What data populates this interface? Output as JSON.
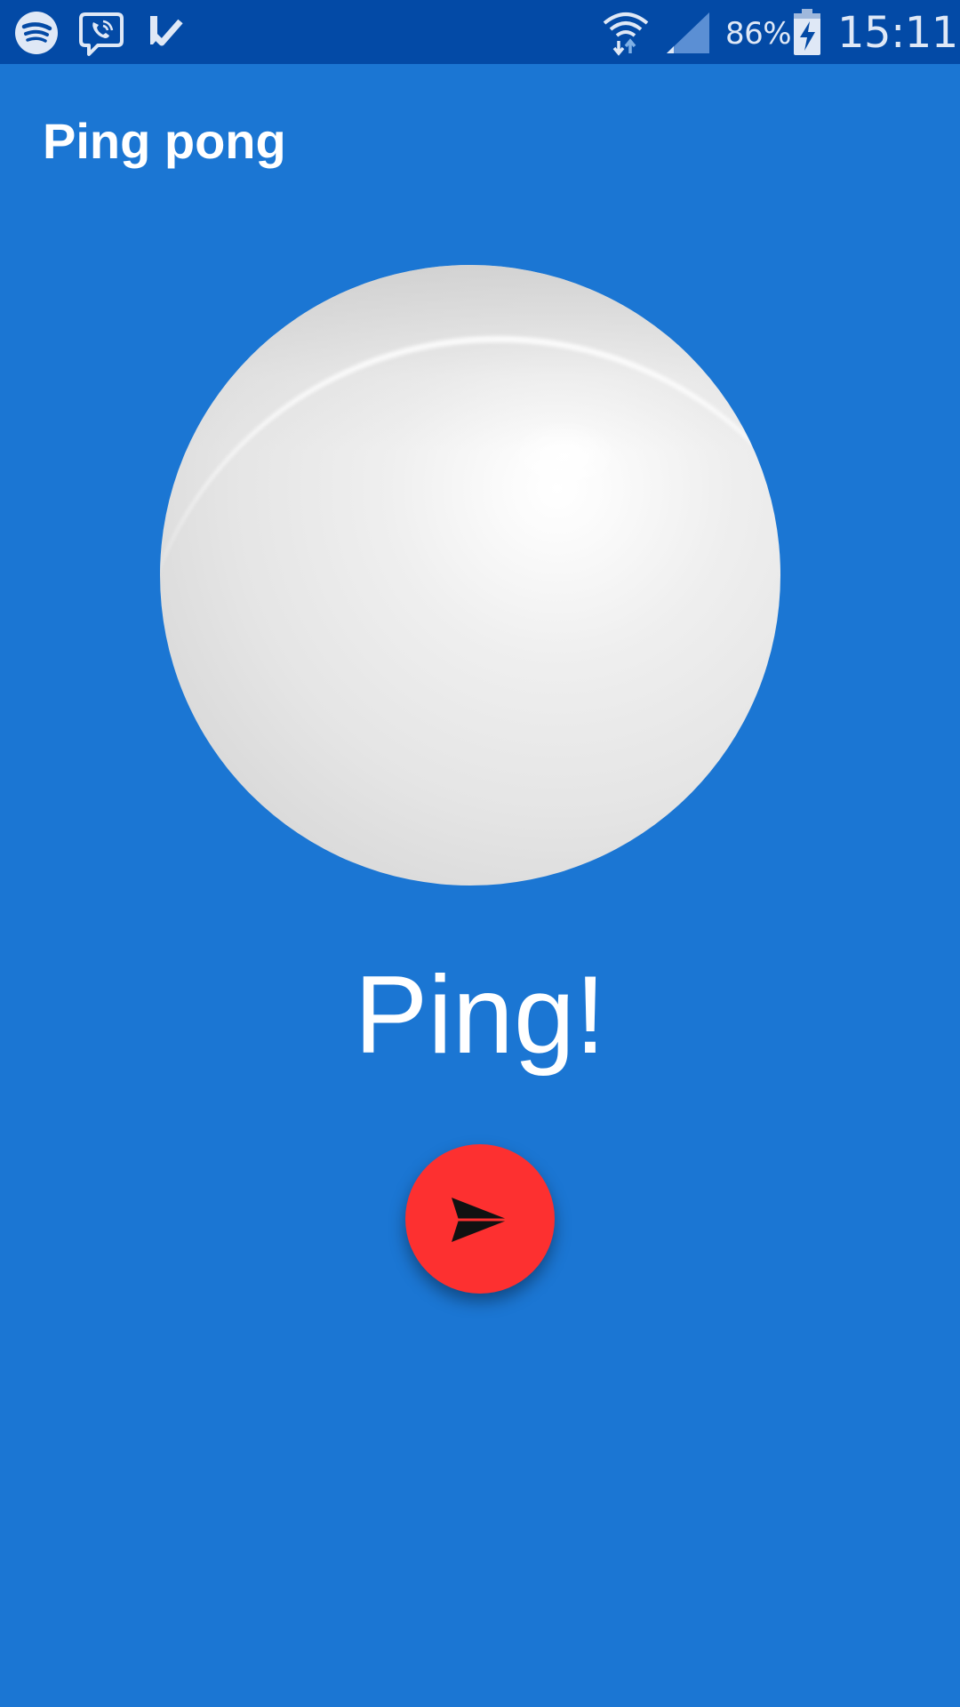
{
  "status_bar": {
    "notification_icons": [
      "spotify-icon",
      "viber-icon",
      "task-check-icon"
    ],
    "system_icons": [
      "wifi-icon",
      "signal-icon",
      "battery-charging-icon"
    ],
    "battery_percent": "86%",
    "time": "15:11"
  },
  "app": {
    "title": "Ping pong"
  },
  "main": {
    "ball_image": "ping-pong-ball",
    "message": "Ping!",
    "send_button_icon": "send-icon"
  },
  "colors": {
    "background": "#1b76d3",
    "status_bar": "#034aa6",
    "fab": "#fd3030",
    "text": "#ffffff"
  }
}
